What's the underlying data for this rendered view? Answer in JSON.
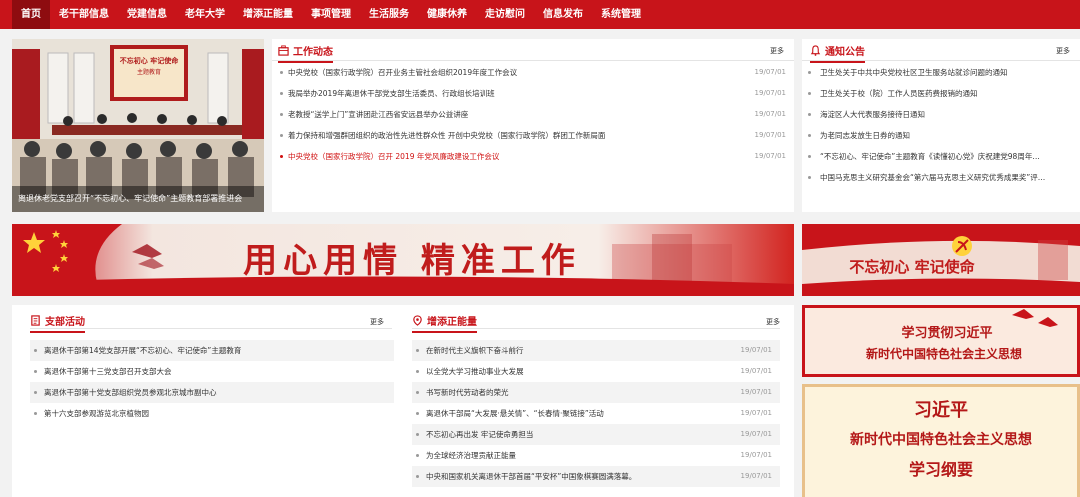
{
  "nav": {
    "items": [
      {
        "label": "首页",
        "active": true
      },
      {
        "label": "老干部信息"
      },
      {
        "label": "党建信息"
      },
      {
        "label": "老年大学"
      },
      {
        "label": "增添正能量"
      },
      {
        "label": "事项管理"
      },
      {
        "label": "生活服务"
      },
      {
        "label": "健康休养"
      },
      {
        "label": "走访慰问"
      },
      {
        "label": "信息发布"
      },
      {
        "label": "系统管理"
      }
    ]
  },
  "photo": {
    "board_line1": "不忘初心 牢记使命",
    "board_line2": "主题教育",
    "caption": "离退休老党支部召开“不忘初心、牢记使命”主题教育部署推进会"
  },
  "work": {
    "title": "工作动态",
    "more": "更多",
    "items": [
      {
        "text": "中央党校（国家行政学院）召开业务主管社会组织2019年度工作会议",
        "date": "19/07/01"
      },
      {
        "text": "我局举办2019年离退休干部党支部生活委员、行政组长培训班",
        "date": "19/07/01"
      },
      {
        "text": "老教授“送学上门”宣讲团赴江西省安远县举办公益讲座",
        "date": "19/07/01"
      },
      {
        "text": "着力保持和增强群团组织的政治性先进性群众性 开创中央党校（国家行政学院）群团工作新局面",
        "date": "19/07/01"
      },
      {
        "text": "中央党校（国家行政学院）召开 2019 年党风廉政建设工作会议",
        "date": "19/07/01",
        "red": true
      }
    ]
  },
  "notice": {
    "title": "通知公告",
    "more": "更多",
    "items": [
      {
        "text": "卫生处关于中共中央党校社区卫生服务站就诊问题的通知"
      },
      {
        "text": "卫生处关于校（院）工作人员医药费报销的通知"
      },
      {
        "text": "海淀区人大代表服务接待日通知"
      },
      {
        "text": "为老同志发放生日券的通知"
      },
      {
        "text": "“不忘初心、牢记使命”主题教育《读懂初心党》庆祝建党98周年…"
      },
      {
        "text": "中国马克思主义研究基金会“第六届马克思主义研究优秀成果奖”评…"
      }
    ]
  },
  "banners": {
    "main": "用心用情 精准工作",
    "side1": "不忘初心 牢记使命",
    "side2_line1": "学习贯彻习近平",
    "side2_line2": "新时代中国特色社会主义思想",
    "side3_line1": "习近平",
    "side3_line2": "新时代中国特色社会主义思想",
    "side3_line3": "学习纲要"
  },
  "branch": {
    "title": "支部活动",
    "more": "更多",
    "items": [
      {
        "text": "离退休干部第14党支部开展“不忘初心、牢记使命”主题教育"
      },
      {
        "text": "离退休干部第十三党支部召开支部大会"
      },
      {
        "text": "离退休干部第十党支部组织党员参观北京城市副中心"
      },
      {
        "text": "第十六支部参观游览北京植物园"
      }
    ]
  },
  "energy": {
    "title": "增添正能量",
    "more": "更多",
    "items": [
      {
        "text": "在新时代主义旗帜下奋斗前行",
        "date": "19/07/01"
      },
      {
        "text": "以全党大学习推动事业大发展",
        "date": "19/07/01"
      },
      {
        "text": "书写新时代劳动者的荣光",
        "date": "19/07/01"
      },
      {
        "text": "离退休干部局“大发展·悬关情”、“长春情·聚链接”活动",
        "date": "19/07/01"
      },
      {
        "text": "不忘初心再出发 牢记使命勇担当",
        "date": "19/07/01"
      },
      {
        "text": "为全球经济治理贡献正能量",
        "date": "19/07/01"
      },
      {
        "text": "中央和国家机关离退休干部首届“平安杯”中国象棋赛圆满落幕。",
        "date": "19/07/01"
      }
    ]
  },
  "colors": {
    "brand": "#c8141a",
    "nav_active": "#8e0c10"
  }
}
